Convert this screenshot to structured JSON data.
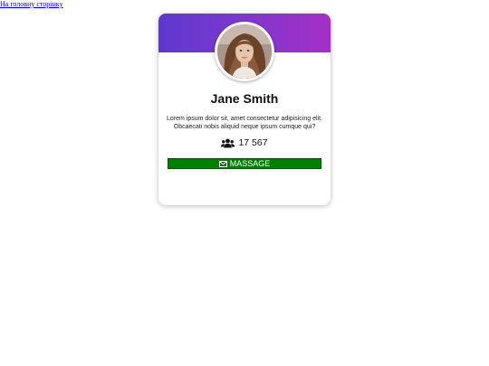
{
  "home_link": "На головну сторінку",
  "profile": {
    "name": "Jane Smith",
    "description": "Lorem ipsum dolor sit, amet consectetur adipisicing elit. Obcaecati nobis aliquid neque ipsum cumque qui?",
    "followers_icon": "users-icon",
    "followers": "17 567",
    "message_icon": "envelope-icon",
    "message_label": "MASSAGE"
  },
  "colors": {
    "banner_start": "#5f38cf",
    "banner_end": "#a62fc6",
    "button": "#008000"
  }
}
